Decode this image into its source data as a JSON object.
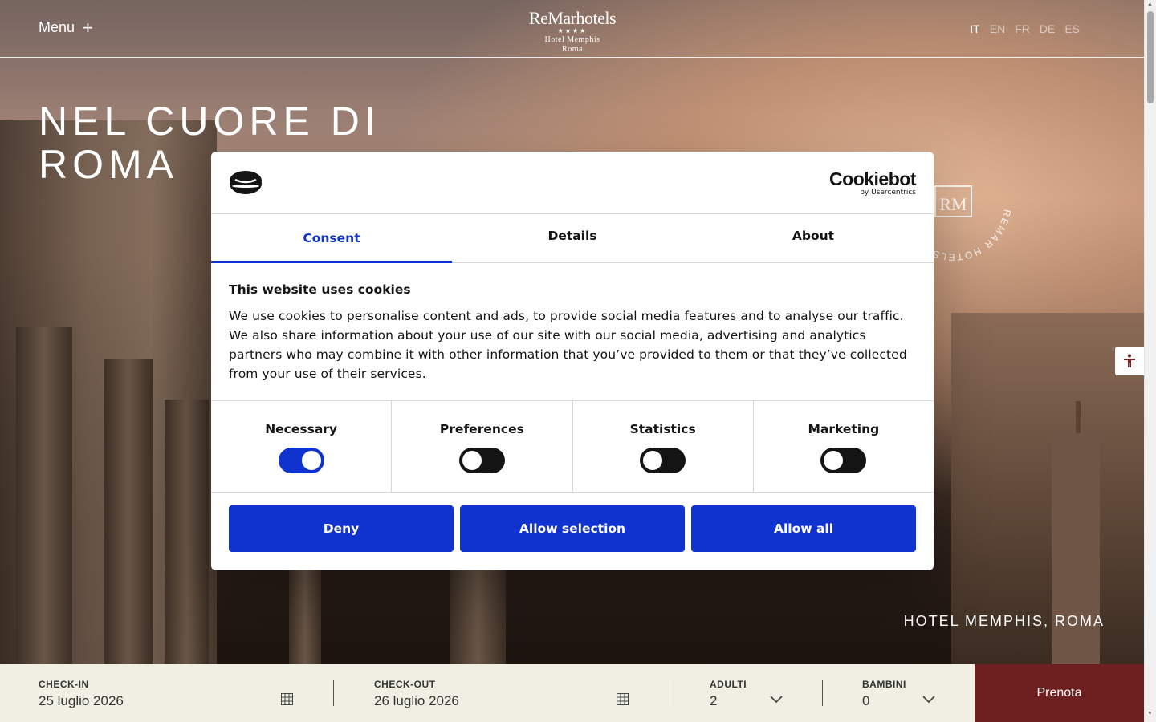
{
  "header": {
    "menu_label": "Menu",
    "menu_icon": "plus-icon",
    "logo": {
      "brand": "ReMarhotels",
      "stars": "★★★★",
      "line1": "Hotel Memphis",
      "line2": "Roma"
    },
    "languages": [
      "IT",
      "EN",
      "FR",
      "DE",
      "ES"
    ],
    "active_language": "IT"
  },
  "hero": {
    "title": "NEL CUORE DI ROMA",
    "badge_text": "REMAR HOTELS HOTEL MEMPHIS REMAR HOTELS",
    "badge_monogram": "RM",
    "caption": "HOTEL MEMPHIS, ROMA"
  },
  "booking": {
    "checkin_label": "CHECK-IN",
    "checkin_value": "25 luglio 2026",
    "checkout_label": "CHECK-OUT",
    "checkout_value": "26 luglio 2026",
    "adults_label": "ADULTI",
    "adults_value": "2",
    "children_label": "BAMBINI",
    "children_value": "0",
    "submit_label": "Prenota"
  },
  "cookie_dialog": {
    "provider_name": "Cookiebot",
    "provider_sub": "by Usercentrics",
    "tabs": [
      "Consent",
      "Details",
      "About"
    ],
    "active_tab": "Consent",
    "title": "This website uses cookies",
    "text": "We use cookies to personalise content and ads, to provide social media features and to analyse our traffic. We also share information about your use of our site with our social media, advertising and analytics partners who may combine it with other information that you’ve provided to them or that they’ve collected from your use of their services.",
    "categories": [
      {
        "label": "Necessary",
        "enabled": true
      },
      {
        "label": "Preferences",
        "enabled": false
      },
      {
        "label": "Statistics",
        "enabled": false
      },
      {
        "label": "Marketing",
        "enabled": false
      }
    ],
    "buttons": {
      "deny": "Deny",
      "allow_selection": "Allow selection",
      "allow_all": "Allow all"
    },
    "accent_color": "#1032cf"
  },
  "colors": {
    "booking_bar_bg": "#f0efe3",
    "prenota_bg": "#6e1f1f"
  }
}
